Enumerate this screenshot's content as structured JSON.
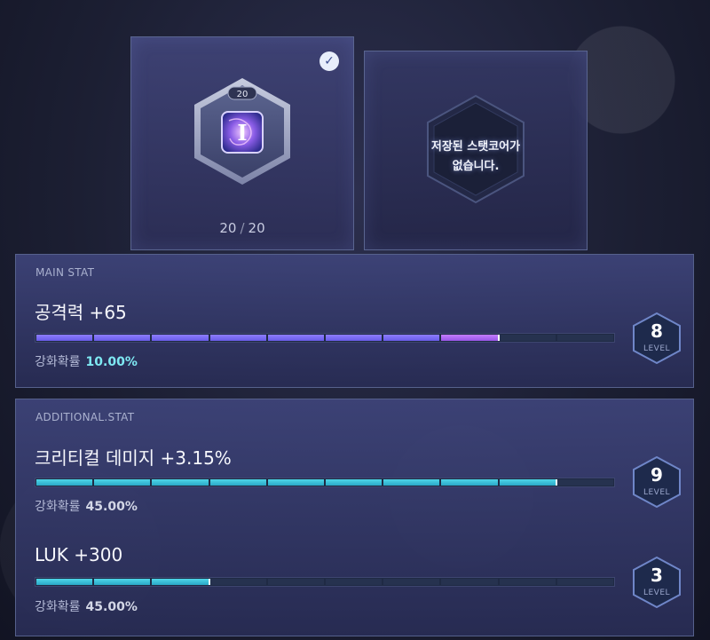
{
  "core": {
    "level_text": "20",
    "count_current": "20",
    "count_separator": "/",
    "count_max": "20",
    "selected": true,
    "selected_icon": "checkmark-circle-icon",
    "icon": "symbol-core-icon",
    "glyph": "I"
  },
  "empty_slot": {
    "line1": "저장된 스탯코어가",
    "line2": "없습니다."
  },
  "main_stat": {
    "section_title": "MAIN STAT",
    "label": "공격력 +65",
    "progress_segments_filled": 8,
    "progress_segments_total": 10,
    "probability_label": "강화확률",
    "probability_value": "10.00%",
    "level": "8",
    "level_word": "LEVEL",
    "bar_color": "#7a6cf0"
  },
  "additional_stat": {
    "section_title": "ADDITIONAL.STAT",
    "stats": [
      {
        "label": "크리티컬 데미지 +3.15%",
        "progress_segments_filled": 9,
        "progress_segments_total": 10,
        "probability_label": "강화확률",
        "probability_value": "45.00%",
        "level": "9",
        "level_word": "LEVEL"
      },
      {
        "label": "LUK +300",
        "progress_segments_filled": 3,
        "progress_segments_total": 10,
        "probability_label": "강화확률",
        "probability_value": "45.00%",
        "level": "3",
        "level_word": "LEVEL"
      }
    ],
    "bar_color": "#3cc4dc"
  }
}
